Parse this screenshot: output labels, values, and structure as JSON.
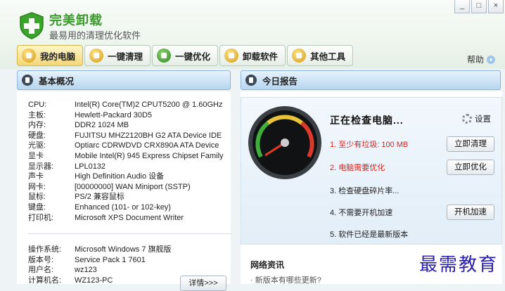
{
  "app": {
    "title": "完美卸载",
    "subtitle": "最易用的清理优化软件"
  },
  "window_buttons": {
    "minimize": "_",
    "maximize": "□",
    "close": "×"
  },
  "tabs": [
    {
      "label": "我的电脑",
      "active": true
    },
    {
      "label": "一键清理",
      "active": false
    },
    {
      "label": "一键优化",
      "active": false
    },
    {
      "label": "卸载软件",
      "active": false
    },
    {
      "label": "其他工具",
      "active": false
    }
  ],
  "help": {
    "label": "帮助"
  },
  "overview": {
    "title": "基本概况",
    "hardware": [
      {
        "k": "CPU:",
        "v": "Intel(R) Core(TM)2 CPUT5200  @ 1.60GHz"
      },
      {
        "k": "主板:",
        "v": "Hewlett-Packard 30D5"
      },
      {
        "k": "内存:",
        "v": "DDR2 1024 MB"
      },
      {
        "k": "硬盘:",
        "v": "FUJITSU MHZ2120BH G2 ATA Device IDE"
      },
      {
        "k": "光驱:",
        "v": "Optiarc CDRWDVD CRX890A ATA Device"
      },
      {
        "k": "显卡",
        "v": "Mobile Intel(R) 945 Express Chipset Family"
      },
      {
        "k": "显示器:",
        "v": "LPL0132"
      },
      {
        "k": "声卡",
        "v": "High Definition Audio 设备"
      },
      {
        "k": "网卡:",
        "v": "[00000000] WAN Miniport (SSTP)"
      },
      {
        "k": "鼠标:",
        "v": "PS/2 兼容鼠标"
      },
      {
        "k": "键盘:",
        "v": "Enhanced (101- or 102-key)"
      },
      {
        "k": "打印机:",
        "v": "Microsoft XPS Document Writer"
      }
    ],
    "system": [
      {
        "k": "操作系统:",
        "v": "Microsoft Windows 7 旗舰版"
      },
      {
        "k": "版本号:",
        "v": "Service Pack 1 7601"
      },
      {
        "k": "用户名:",
        "v": "wz123"
      },
      {
        "k": "计算机名:",
        "v": "WZ123-PC"
      }
    ],
    "details_button": "详情>>>"
  },
  "report": {
    "title": "今日报告",
    "status": "正在检查电脑...",
    "settings_label": "设置",
    "items": [
      {
        "text": "1. 至少有垃圾: 100 MB",
        "alert": true,
        "button": "立即清理"
      },
      {
        "text": "2. 电脑需要优化",
        "alert": true,
        "button": "立即优化"
      },
      {
        "text": "3. 检查硬盘碎片率...",
        "alert": false,
        "button": ""
      },
      {
        "text": "4. 不需要开机加速",
        "alert": false,
        "button": "开机加速"
      },
      {
        "text": "5. 软件已经是最新版本",
        "alert": false,
        "button": ""
      }
    ]
  },
  "news": {
    "title": "网络资讯",
    "items": [
      "· 新版本有哪些更新?"
    ]
  },
  "watermark": "最需教育"
}
